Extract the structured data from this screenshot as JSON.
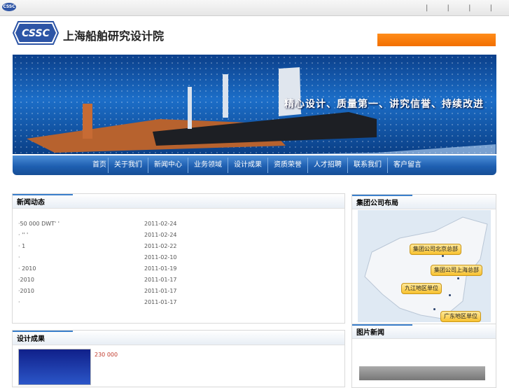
{
  "topbar": {
    "logo_text": "CSSC",
    "separators": "| | | |"
  },
  "header": {
    "logo_text": "CSSC",
    "site_name": "上海船舶研究设计院"
  },
  "banner": {
    "slogan": "精心设计、质量第一、讲究信誉、持续改进"
  },
  "nav": {
    "items": [
      "首页",
      "关于我们",
      "新闻中心",
      "业务领域",
      "设计成果",
      "资质荣誉",
      "人才招聘",
      "联系我们",
      "客户留言"
    ]
  },
  "news": {
    "title": "新闻动态",
    "items": [
      {
        "text": "·50 000 DWT' '",
        "date": "2011-02-24"
      },
      {
        "text": "·     '' '",
        "date": "2011-02-24"
      },
      {
        "text": "·          1",
        "date": "2011-02-22"
      },
      {
        "text": "·",
        "date": "2011-02-10"
      },
      {
        "text": "·    2010",
        "date": "2011-01-19"
      },
      {
        "text": "·2010",
        "date": "2011-01-17"
      },
      {
        "text": "·2010",
        "date": "2011-01-17"
      },
      {
        "text": "·",
        "date": "2011-01-17"
      }
    ]
  },
  "products": {
    "title": "设计成果",
    "item_text": "230 000"
  },
  "sidebar": {
    "map_title": "集团公司布局",
    "map_labels": [
      "集团公司北京总部",
      "集团公司上海总部",
      "九江地区单位",
      "广东地区单位"
    ],
    "photo_title": "图片新闻"
  },
  "colors": {
    "brand_blue": "#1e5fb1",
    "accent_orange": "#f26f00"
  }
}
